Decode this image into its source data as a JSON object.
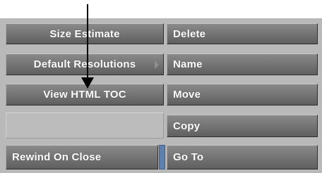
{
  "menu": {
    "left": {
      "size_estimate": "Size Estimate",
      "default_resolutions": "Default Resolutions",
      "view_html_toc": "View HTML TOC",
      "rewind_on_close": "Rewind On Close"
    },
    "right": {
      "delete": "Delete",
      "name": "Name",
      "move": "Move",
      "copy": "Copy",
      "go_to": "Go To"
    }
  },
  "colors": {
    "button_face": "#6f6f6f",
    "panel_background": "#b9b9b9",
    "toggle_indicator": "#5f7fae",
    "button_text": "#ffffff"
  },
  "icons": [
    "submenu-arrow-icon",
    "annotation-pointer-arrow"
  ]
}
